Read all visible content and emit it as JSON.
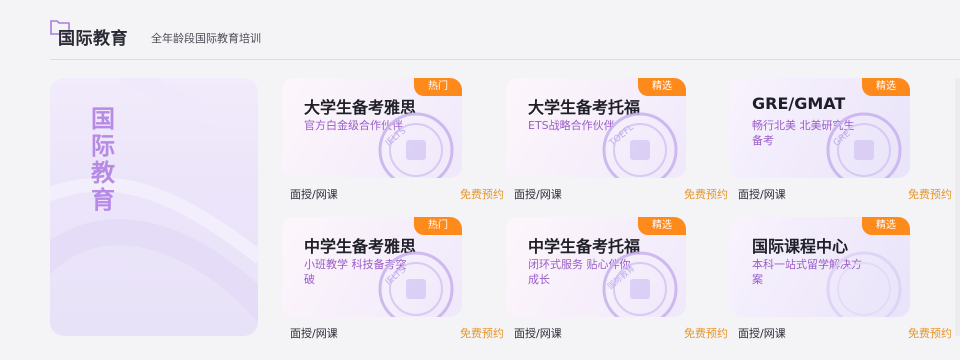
{
  "header": {
    "title": "国际教育",
    "subtitle": "全年龄段国际教育培训"
  },
  "hero": {
    "title_chars": [
      "国",
      "际",
      "教",
      "育"
    ]
  },
  "cards": [
    {
      "title": "大学生备考雅思",
      "badge": "热门",
      "desc": "官方白金级合作伙伴",
      "stamp": "IELTS",
      "foot_left": "面授/网课",
      "foot_right": "免费预约"
    },
    {
      "title": "大学生备考托福",
      "badge": "精选",
      "desc": "ETS战略合作伙伴",
      "stamp": "TOEFL",
      "foot_left": "面授/网课",
      "foot_right": "免费预约"
    },
    {
      "title": "GRE/GMAT",
      "badge": "精选",
      "desc": "畅行北美 北美研究生备考",
      "stamp": "GRE",
      "foot_left": "面授/网课",
      "foot_right": "免费预约"
    },
    {
      "title": "中学生备考雅思",
      "badge": "热门",
      "desc": "小班教学 科技备考突破",
      "stamp": "IELTS",
      "foot_left": "面授/网课",
      "foot_right": "免费预约"
    },
    {
      "title": "中学生备考托福",
      "badge": "精选",
      "desc": "闭环式服务 贴心伴你成长",
      "stamp": "国际教育",
      "foot_left": "面授/网课",
      "foot_right": "免费预约"
    },
    {
      "title": "国际课程中心",
      "badge": "精选",
      "desc": "本科一站式留学解决方案",
      "stamp": "",
      "foot_left": "面授/网课",
      "foot_right": "免费预约"
    }
  ],
  "colors": {
    "badge": "#ff8a1c",
    "accent_purple": "#b78ae6",
    "foot_link": "#e7962c"
  }
}
